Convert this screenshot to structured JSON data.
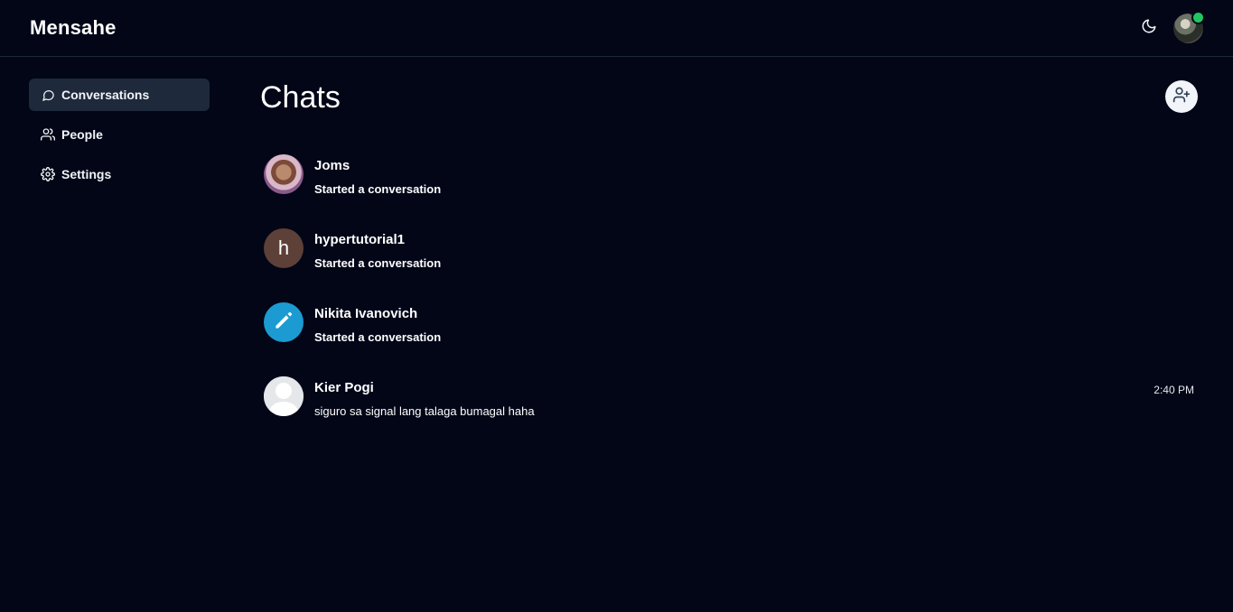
{
  "app": {
    "brand": "Mensahe"
  },
  "header": {
    "theme_icon": "moon-icon",
    "user_status": "online",
    "status_color": "#22c55e"
  },
  "sidebar": {
    "items": [
      {
        "label": "Conversations",
        "icon": "message-circle-icon",
        "active": true
      },
      {
        "label": "People",
        "icon": "users-icon",
        "active": false
      },
      {
        "label": "Settings",
        "icon": "gear-icon",
        "active": false
      }
    ]
  },
  "main": {
    "title": "Chats",
    "add_button_icon": "user-plus-icon",
    "conversations": [
      {
        "name": "Joms",
        "preview": "Started a conversation",
        "time": "",
        "avatar": "photo"
      },
      {
        "name": "hypertutorial1",
        "preview": "Started a conversation",
        "time": "",
        "avatar_letter": "h"
      },
      {
        "name": "Nikita Ivanovich",
        "preview": "Started a conversation",
        "time": "",
        "avatar": "pencil-icon"
      },
      {
        "name": "Kier Pogi",
        "preview": "siguro sa signal lang talaga bumagal haha",
        "time": "2:40 PM",
        "avatar": "default-user"
      }
    ]
  },
  "colors": {
    "background": "#020617",
    "active_nav": "#1e293b",
    "divider": "#1e293b"
  }
}
